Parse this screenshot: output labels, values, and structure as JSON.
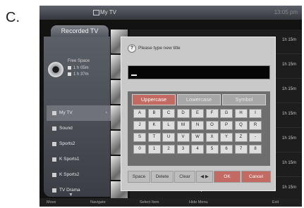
{
  "figure_letter": "C.",
  "topbar": {
    "title": "My TV",
    "clock": "13:05 pm"
  },
  "tab": {
    "label": "Recorded TV"
  },
  "sidebar": {
    "free_space_label": "Free Space",
    "free_space_rows": [
      "1 h 05m",
      "1 h 37m"
    ],
    "items": [
      {
        "label": "My TV",
        "active": true
      },
      {
        "label": "Sound"
      },
      {
        "label": "Sports2"
      },
      {
        "label": "K Sports1"
      },
      {
        "label": "K Sports2"
      },
      {
        "label": "TV Drama"
      }
    ]
  },
  "list": {
    "times": [
      "1h 15m",
      "1h 15m",
      "1h 15m",
      "1h 15m",
      "1h 15m",
      "1h 15m",
      "1h 15m"
    ]
  },
  "dialog": {
    "title": "Please type new title",
    "input_value": "",
    "tabs": [
      "Uppercase",
      "Lowercase",
      "Symbol"
    ],
    "keys": [
      [
        "A",
        "B",
        "C",
        "D",
        "E",
        "F",
        "G",
        "H",
        "I"
      ],
      [
        "J",
        "K",
        "L",
        "M",
        "N",
        "O",
        "P",
        "Q",
        "R"
      ],
      [
        "S",
        "T",
        "U",
        "V",
        "W",
        "X",
        "Y",
        "Z",
        "-"
      ],
      [
        "0",
        "1",
        "2",
        "3",
        "4",
        "5",
        "6",
        "7",
        "8"
      ]
    ],
    "buttons": [
      "Space",
      "Delete",
      "Clear",
      "◀ ▶",
      "OK",
      "Cancel"
    ]
  },
  "footer": [
    "Move",
    "Navigate",
    "Select Item",
    "Hide Menu",
    "Exit"
  ]
}
